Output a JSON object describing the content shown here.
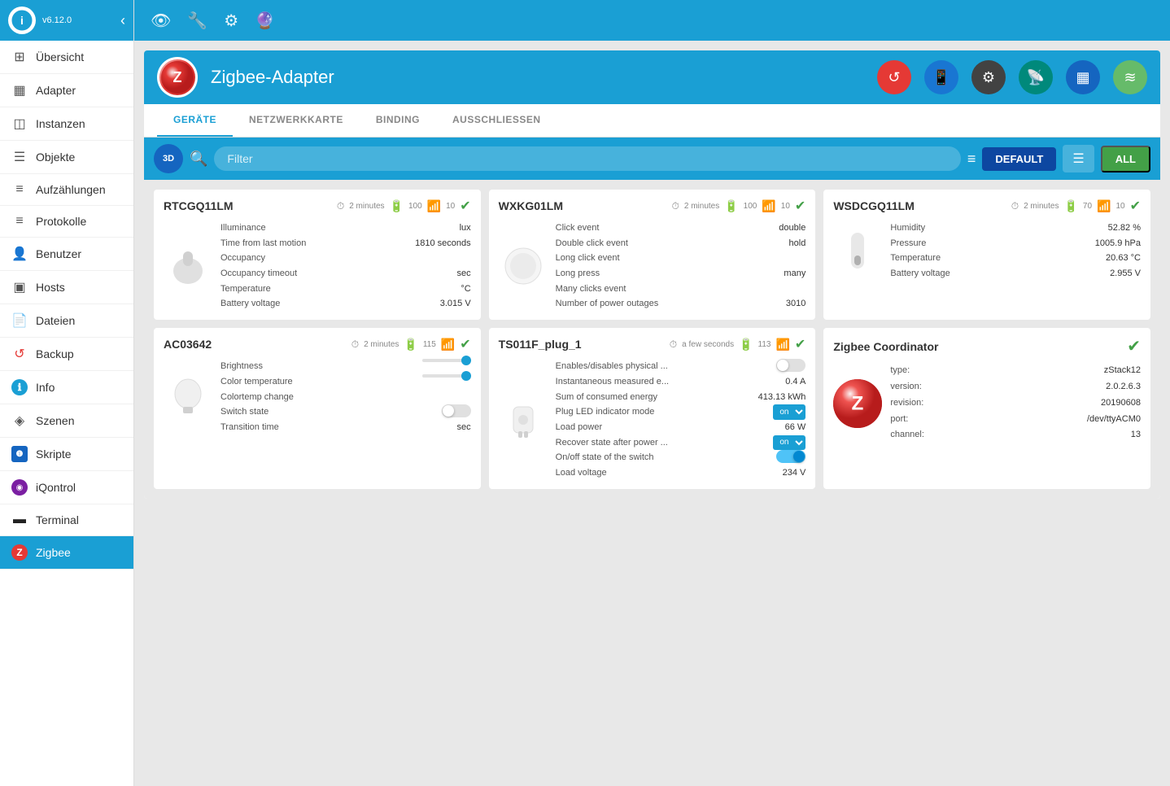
{
  "app": {
    "version": "v6.12.0",
    "logo_letter": "i"
  },
  "sidebar": {
    "items": [
      {
        "id": "ubersicht",
        "label": "Übersicht",
        "icon": "⊞"
      },
      {
        "id": "adapter",
        "label": "Adapter",
        "icon": "▦"
      },
      {
        "id": "instanzen",
        "label": "Instanzen",
        "icon": "◫"
      },
      {
        "id": "objekte",
        "label": "Objekte",
        "icon": "☰"
      },
      {
        "id": "aufzahlungen",
        "label": "Aufzählungen",
        "icon": "≡"
      },
      {
        "id": "protokolle",
        "label": "Protokolle",
        "icon": "≡"
      },
      {
        "id": "benutzer",
        "label": "Benutzer",
        "icon": "👤"
      },
      {
        "id": "hosts",
        "label": "Hosts",
        "icon": "▣"
      },
      {
        "id": "dateien",
        "label": "Dateien",
        "icon": "📄"
      },
      {
        "id": "backup",
        "label": "Backup",
        "icon": "↺"
      },
      {
        "id": "info",
        "label": "Info",
        "icon": "ℹ"
      },
      {
        "id": "szenen",
        "label": "Szenen",
        "icon": "◈"
      },
      {
        "id": "skripte",
        "label": "Skripte",
        "icon": "❶"
      },
      {
        "id": "iqontrol",
        "label": "iQontrol",
        "icon": "◉"
      },
      {
        "id": "terminal",
        "label": "Terminal",
        "icon": "▬"
      },
      {
        "id": "zigbee",
        "label": "Zigbee",
        "icon": "Z",
        "active": true
      }
    ]
  },
  "toolbar": {
    "icons": [
      "👁",
      "🔧",
      "⚙",
      "🔮"
    ]
  },
  "panel": {
    "title": "Zigbee-Adapter",
    "tabs": [
      "GERÄTE",
      "NETZWERKKARTE",
      "BINDING",
      "AUSSCHLIESSEN"
    ],
    "active_tab": "GERÄTE",
    "filter_placeholder": "Filter",
    "view_buttons": [
      "DEFAULT",
      "ALL"
    ],
    "active_view": "DEFAULT"
  },
  "devices": [
    {
      "id": "RTCGQ11LM",
      "name": "RTCGQ11LM",
      "time": "2 minutes",
      "battery": "100",
      "signal": "10",
      "status": "ok",
      "icon": "🏠",
      "props": [
        {
          "name": "Illuminance",
          "value": "lux"
        },
        {
          "name": "Time from last motion",
          "value": "1810 seconds"
        },
        {
          "name": "Occupancy",
          "value": ""
        },
        {
          "name": "Occupancy timeout",
          "value": "sec"
        },
        {
          "name": "Temperature",
          "value": "°C"
        },
        {
          "name": "Battery voltage",
          "value": "3.015 V"
        }
      ]
    },
    {
      "id": "WXKG01LM",
      "name": "WXKG01LM",
      "time": "2 minutes",
      "battery": "100",
      "signal": "10",
      "status": "ok",
      "icon": "⚪",
      "props": [
        {
          "name": "Click event",
          "value": "double"
        },
        {
          "name": "Double click event",
          "value": "hold"
        },
        {
          "name": "Long click event",
          "value": ""
        },
        {
          "name": "Long press",
          "value": "many"
        },
        {
          "name": "Many clicks event",
          "value": ""
        },
        {
          "name": "Number of power outages",
          "value": "3010"
        }
      ]
    },
    {
      "id": "WSDCGQ11LM",
      "name": "WSDCGQ11LM",
      "time": "2 minutes",
      "battery": "70",
      "signal": "10",
      "battery_color": "orange",
      "status": "ok",
      "icon": "🌡",
      "props": [
        {
          "name": "Humidity",
          "value": "52.82 %"
        },
        {
          "name": "Pressure",
          "value": "1005.9 hPa"
        },
        {
          "name": "Temperature",
          "value": "20.63 °C"
        },
        {
          "name": "Battery voltage",
          "value": "2.955 V"
        }
      ]
    },
    {
      "id": "AC03642",
      "name": "AC03642",
      "time": "2 minutes",
      "battery": "115",
      "signal": "",
      "status": "ok",
      "icon": "💡",
      "props": [
        {
          "name": "Brightness",
          "value": "",
          "type": "slider"
        },
        {
          "name": "Color temperature",
          "value": "",
          "type": "slider"
        },
        {
          "name": "Colortemp change",
          "value": ""
        },
        {
          "name": "Switch state",
          "value": "",
          "type": "toggle",
          "on": false
        },
        {
          "name": "Transition time",
          "value": "sec"
        }
      ]
    },
    {
      "id": "TS011F_plug_1",
      "name": "TS011F_plug_1",
      "time": "a few seconds",
      "battery": "113",
      "signal": "",
      "status": "ok",
      "icon": "🔌",
      "props": [
        {
          "name": "Enables/disables physical ...",
          "value": "",
          "type": "toggle",
          "on": false
        },
        {
          "name": "Instantaneous measured e...",
          "value": "0.4 A"
        },
        {
          "name": "Sum of consumed energy",
          "value": "413.13 kWh"
        },
        {
          "name": "Plug LED indicator mode",
          "value": "on",
          "type": "dropdown"
        },
        {
          "name": "Load power",
          "value": "66 W"
        },
        {
          "name": "Recover state after power ...",
          "value": "on",
          "type": "dropdown"
        },
        {
          "name": "On/off state of the switch",
          "value": "",
          "type": "toggle",
          "on": true
        },
        {
          "name": "Load voltage",
          "value": "234 V"
        }
      ]
    },
    {
      "id": "zigbee_coordinator",
      "name": "Zigbee Coordinator",
      "status": "ok",
      "is_coordinator": true,
      "props": [
        {
          "name": "type:",
          "value": "zStack12"
        },
        {
          "name": "version:",
          "value": "2.0.2.6.3"
        },
        {
          "name": "revision:",
          "value": "20190608"
        },
        {
          "name": "port:",
          "value": "/dev/ttyACM0"
        },
        {
          "name": "channel:",
          "value": "13"
        }
      ]
    }
  ]
}
